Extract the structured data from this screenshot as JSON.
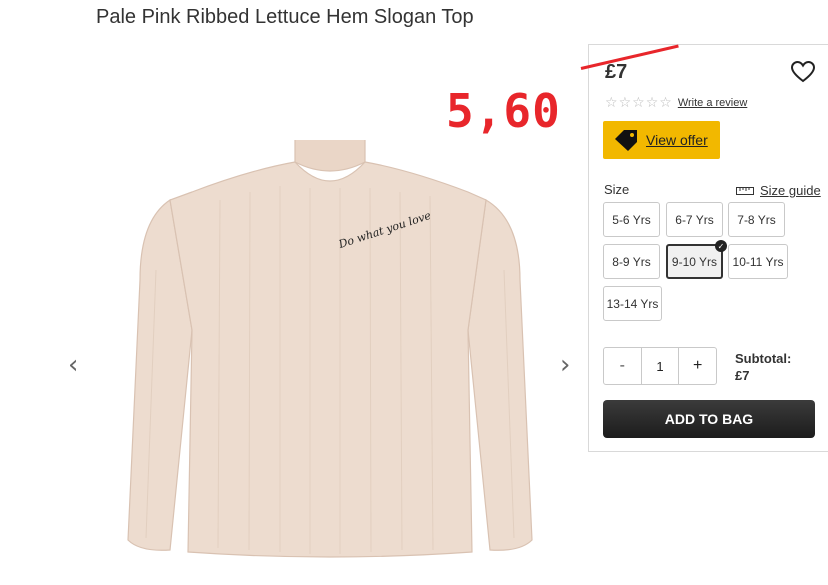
{
  "product": {
    "title": "Pale Pink Ribbed Lettuce Hem Slogan Top",
    "garment_slogan": "Do what you love"
  },
  "gallery": {
    "prev_icon": "chevron-left-icon",
    "next_icon": "chevron-right-icon",
    "prev_glyph": "‹",
    "next_glyph": "›",
    "garment_color": "#eddccf"
  },
  "annotation": {
    "new_price": "5,60",
    "color": "#e8262b"
  },
  "panel": {
    "price": "£7",
    "rating_stars": 5,
    "star_glyph": "☆",
    "write_review": "Write a review",
    "view_offer": "View offer",
    "view_offer_color": "#f2b800",
    "size_label": "Size",
    "size_guide": "Size guide",
    "sizes": [
      {
        "label": "5-6 Yrs",
        "selected": false
      },
      {
        "label": "6-7 Yrs",
        "selected": false
      },
      {
        "label": "7-8 Yrs",
        "selected": false
      },
      {
        "label": "8-9 Yrs",
        "selected": false
      },
      {
        "label": "9-10 Yrs",
        "selected": true
      },
      {
        "label": "10-11 Yrs",
        "selected": false
      },
      {
        "label": "13-14 Yrs",
        "selected": false
      }
    ],
    "qty_minus": "-",
    "qty_value": "1",
    "qty_plus": "+",
    "subtotal_label": "Subtotal:",
    "subtotal_value": "£7",
    "add_to_bag": "ADD TO BAG"
  }
}
